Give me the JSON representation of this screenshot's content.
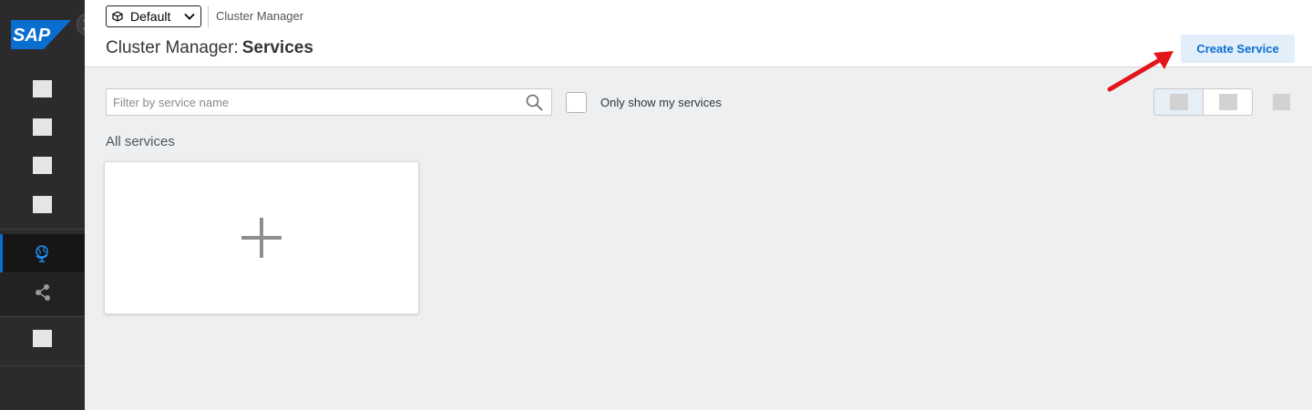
{
  "brand": {
    "logo_text": "SAP",
    "logo_color": "#0a6ed1"
  },
  "header": {
    "namespace_selected": "Default",
    "breadcrumb": "Cluster Manager",
    "title_prefix": "Cluster Manager:",
    "title_main": "Services",
    "create_button_label": "Create Service"
  },
  "toolbar": {
    "filter_placeholder": "Filter by service name",
    "filter_value": "",
    "only_mine_label": "Only show my services",
    "only_mine_checked": false
  },
  "main": {
    "section_title": "All services"
  },
  "colors": {
    "accent": "#0a6ed1",
    "annotation_arrow": "#e3161c",
    "sidebar_bg": "#2b2b2b",
    "page_bg": "#edeff1"
  }
}
